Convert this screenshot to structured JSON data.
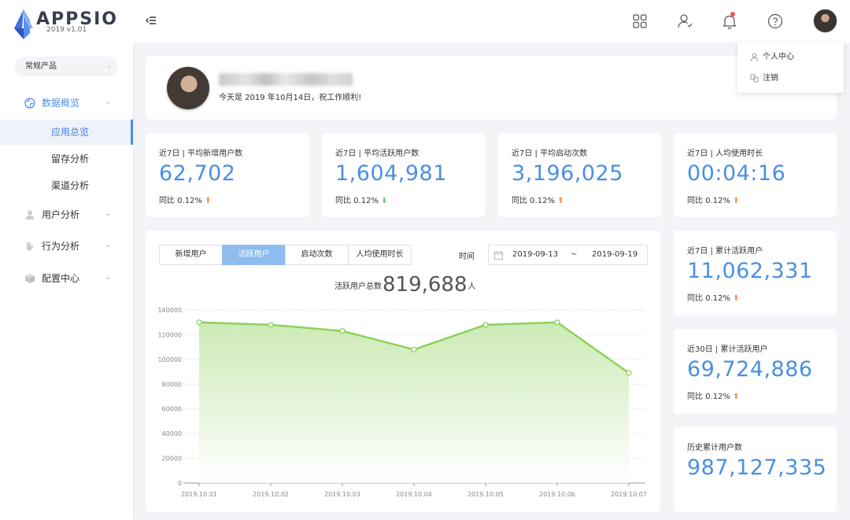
{
  "brand": {
    "name": "APPSIO",
    "version": "2019 v1.01"
  },
  "sidebar": {
    "product": "常规产品",
    "menu": [
      {
        "label": "数据概览",
        "icon": "globe-icon"
      },
      {
        "label": "用户分析",
        "icon": "user-icon"
      },
      {
        "label": "行为分析",
        "icon": "hand-icon"
      },
      {
        "label": "配置中心",
        "icon": "box-icon"
      }
    ],
    "sub": [
      "应用总览",
      "留存分析",
      "渠道分析"
    ]
  },
  "dropdown": {
    "profile": "个人中心",
    "logout": "注销"
  },
  "welcome": {
    "message": "今天是 2019 年10月14日，祝工作顺利!"
  },
  "stats": [
    {
      "title": "近7日 | 平均新增用户数",
      "value": "62,702",
      "compare": "同比 0.12%",
      "trend": "up"
    },
    {
      "title": "近7日 | 平均活跃用户数",
      "value": "1,604,981",
      "compare": "同比 0.12%",
      "trend": "down"
    },
    {
      "title": "近7日 | 平均启动次数",
      "value": "3,196,025",
      "compare": "同比 0.12%",
      "trend": "up"
    },
    {
      "title": "近7日 | 人均使用时长",
      "value": "00:04:16",
      "compare": "同比 0.12%",
      "trend": "up"
    }
  ],
  "side_stats": [
    {
      "title": "近7日 | 累计活跃用户",
      "value": "11,062,331",
      "compare": "同比 0.12%",
      "trend": "up"
    },
    {
      "title": "近30日 | 累计活跃用户",
      "value": "69,724,886",
      "compare": "同比 0.12%",
      "trend": "up"
    },
    {
      "title": "历史累计用户数",
      "value": "987,127,335"
    }
  ],
  "chart_panel": {
    "tabs": [
      "新增用户",
      "活跃用户",
      "启动次数",
      "人均使用时长"
    ],
    "active_tab": 1,
    "time_label": "时间",
    "date_from": "2019-09-13",
    "date_sep": "~",
    "date_to": "2019-09-19",
    "total_label": "活跃用户总数",
    "total_value": "819,688",
    "total_unit": "人"
  },
  "chart_data": {
    "type": "area",
    "x": [
      "2019.10.01",
      "2019.10.02",
      "2019.10.03",
      "2019.10.04",
      "2019.10.05",
      "2019.10.06",
      "2019.10.07"
    ],
    "series": [
      {
        "values": [
          130000,
          128000,
          123000,
          108000,
          128000,
          130000,
          89000
        ]
      }
    ],
    "ylim": [
      0,
      140000
    ],
    "yticks": [
      0,
      20000,
      40000,
      60000,
      80000,
      100000,
      120000,
      140000
    ],
    "grid": true,
    "colors": {
      "line": "#8dd15b",
      "fill_top": "#c6e8ad",
      "fill_bottom": "#ffffff"
    }
  },
  "colors": {
    "accent": "#4a90e2",
    "up": "#f08c5a",
    "down": "#6cc466"
  }
}
